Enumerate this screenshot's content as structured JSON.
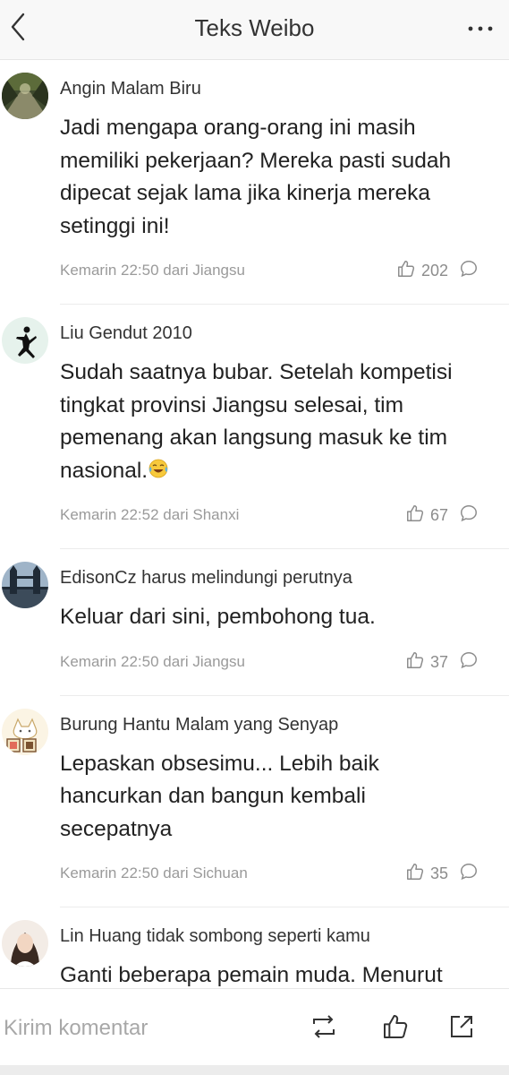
{
  "header": {
    "title": "Teks Weibo",
    "back_icon": "chevron-left-icon",
    "more_icon": "more-dots-icon"
  },
  "comments": [
    {
      "username": "Angin Malam Biru",
      "text": "Jadi mengapa orang-orang ini masih memiliki pekerjaan? Mereka pasti sudah dipecat sejak lama jika kinerja mereka setinggi ini!",
      "time": "Kemarin 22:50 dari Jiangsu",
      "likes": "202",
      "avatar": "forest-path-photo"
    },
    {
      "username": "Liu Gendut 2010",
      "text": "Sudah saatnya bubar. Setelah kompetisi tingkat provinsi Jiangsu selesai, tim pemenang akan langsung masuk ke tim nasional.",
      "emoji": "laughing-crying-emoji",
      "time": "Kemarin 22:52 dari Shanxi",
      "likes": "67",
      "avatar": "jumpman-logo"
    },
    {
      "username": "EdisonCz harus melindungi perutnya",
      "text": "Keluar dari sini, pembohong tua.",
      "time": "Kemarin 22:50 dari Jiangsu",
      "likes": "37",
      "avatar": "tower-bridge-photo"
    },
    {
      "username": "Burung Hantu Malam yang Senyap",
      "text": "Lepaskan obsesimu... Lebih baik hancurkan dan bangun kembali secepatnya",
      "time": "Kemarin 22:50 dari Sichuan",
      "likes": "35",
      "avatar": "cartoon-cat-drawing"
    },
    {
      "username": "Lin Huang tidak sombong seperti kamu",
      "text": "Ganti beberapa pemain muda. Menurut",
      "avatar": "portrait-photo"
    }
  ],
  "bottom_bar": {
    "placeholder": "Kirim komentar",
    "icons": [
      "repost-icon",
      "like-icon",
      "share-icon"
    ]
  },
  "colors": {
    "header_bg": "#f8f8f8",
    "meta_text": "#9a9a9a",
    "divider": "#ececec"
  }
}
